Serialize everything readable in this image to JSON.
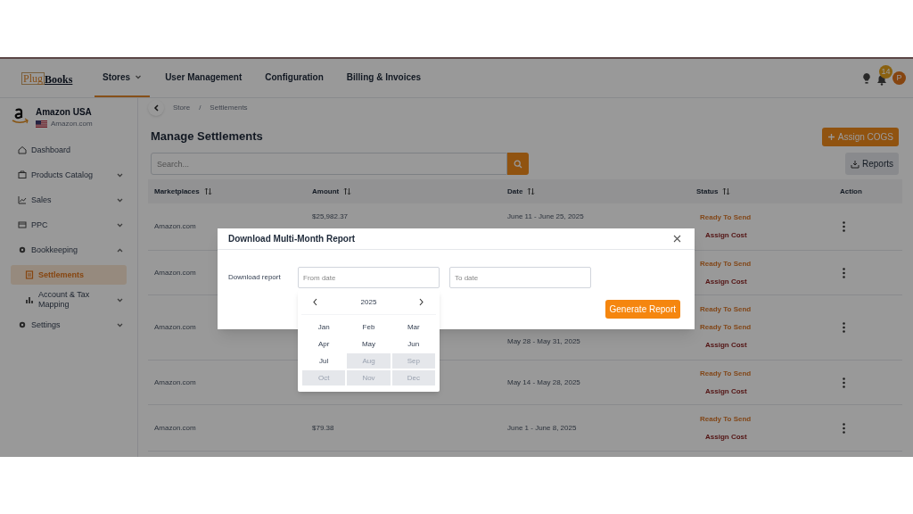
{
  "logo": {
    "part_1": "Plug",
    "part_2": "Books"
  },
  "nav": [
    {
      "label": "Stores",
      "selected": true,
      "dropdown": true
    },
    {
      "label": "User Management",
      "selected": false,
      "dropdown": false
    },
    {
      "label": "Configuration",
      "selected": false,
      "dropdown": false
    },
    {
      "label": "Billing & Invoices",
      "selected": false,
      "dropdown": false
    }
  ],
  "notifications": {
    "count": "14"
  },
  "avatar": "P",
  "store": {
    "name": "Amazon USA",
    "marketplace": "Amazon.com"
  },
  "sidebar": {
    "items": [
      {
        "label": "Dashboard",
        "selected": false
      },
      {
        "label": "Products Catalog",
        "selected": false,
        "expanded": false
      },
      {
        "label": "Sales",
        "selected": false,
        "expanded": false
      },
      {
        "label": "PPC",
        "selected": false,
        "expanded": false
      },
      {
        "label": "Bookkeeping",
        "selected": false,
        "expanded": true,
        "children": [
          {
            "label": "Settlements",
            "selected": true
          },
          {
            "label": "Account & Tax Mapping",
            "selected": false,
            "expanded": false
          }
        ]
      },
      {
        "label": "Settings",
        "selected": false,
        "expanded": false
      }
    ]
  },
  "breadcrumb": {
    "items": [
      "Store",
      "Settlements"
    ],
    "separator": "/"
  },
  "title": "Manage Settlements",
  "search": {
    "placeholder": "Search..."
  },
  "buttons": {
    "assign_cogs": "Assign COGS",
    "reports": "Reports"
  },
  "table": {
    "columns": [
      {
        "label": "Marketplaces",
        "sortable": true
      },
      {
        "label": "Amount",
        "sortable": true
      },
      {
        "label": "Date",
        "sortable": true
      },
      {
        "label": "Status",
        "sortable": true
      },
      {
        "label": "Action",
        "sortable": false
      }
    ],
    "rows": [
      {
        "marketplace": "Amazon.com",
        "amount": "$25,982.37",
        "date": "June 11 - June 25, 2025",
        "status": [
          {
            "text": "Ready To Send",
            "kind": "state"
          },
          {
            "text": "Assign Cost",
            "kind": "action"
          }
        ]
      },
      {
        "marketplace": "Amazon.com",
        "status": [
          {
            "text": "Ready To Send",
            "kind": "state"
          },
          {
            "text": "Assign Cost",
            "kind": "action"
          }
        ]
      },
      {
        "marketplace": "Amazon.com",
        "date": "May 28 - May 31, 2025",
        "status": [
          {
            "text": "Ready To Send",
            "kind": "state"
          },
          {
            "text": "Ready To Send",
            "kind": "state"
          },
          {
            "text": "Assign Cost",
            "kind": "action"
          }
        ]
      },
      {
        "marketplace": "Amazon.com",
        "date": "May 14 - May 28, 2025",
        "status": [
          {
            "text": "Ready To Send",
            "kind": "state"
          },
          {
            "text": "Assign Cost",
            "kind": "action"
          }
        ]
      },
      {
        "marketplace": "Amazon.com",
        "amount": "$79.38",
        "date": "June 1 - June 8, 2025",
        "status": [
          {
            "text": "Ready To Send",
            "kind": "state"
          },
          {
            "text": "Assign Cost",
            "kind": "action"
          }
        ]
      }
    ]
  },
  "modal": {
    "title": "Download Multi-Month Report",
    "label": "Download report",
    "from": {
      "placeholder": "From date"
    },
    "to": {
      "placeholder": "To date"
    },
    "submit": "Generate Report",
    "calendar": {
      "year": "2025",
      "months": [
        {
          "label": "Jan",
          "disabled": false
        },
        {
          "label": "Feb",
          "disabled": false
        },
        {
          "label": "Mar",
          "disabled": false
        },
        {
          "label": "Apr",
          "disabled": false
        },
        {
          "label": "May",
          "disabled": false
        },
        {
          "label": "Jun",
          "disabled": false
        },
        {
          "label": "Jul",
          "disabled": false
        },
        {
          "label": "Aug",
          "disabled": true
        },
        {
          "label": "Sep",
          "disabled": true
        },
        {
          "label": "Oct",
          "disabled": true
        },
        {
          "label": "Nov",
          "disabled": true
        },
        {
          "label": "Dec",
          "disabled": true
        }
      ]
    }
  }
}
